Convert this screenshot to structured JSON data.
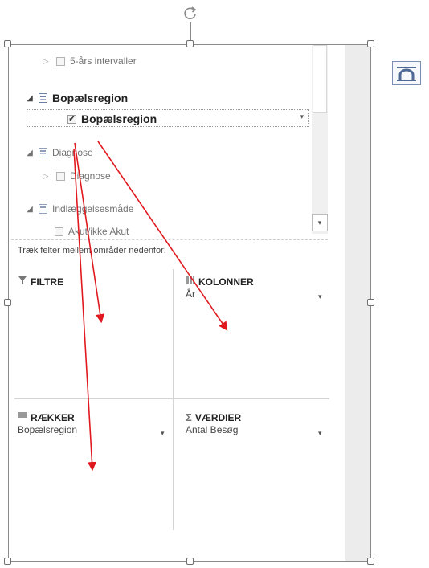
{
  "field_list": {
    "items": [
      {
        "label": "5-års intervaller",
        "level": 1,
        "checked": false,
        "expandable": true
      },
      {
        "label": "Bopælsregion",
        "level": 0,
        "expanded": true,
        "bold": true
      },
      {
        "label": "Bopælsregion",
        "level": 1,
        "checked": true,
        "bold": true,
        "selected": true
      },
      {
        "label": "Diagnose",
        "level": 0,
        "expanded": true
      },
      {
        "label": "Diagnose",
        "level": 1,
        "checked": false,
        "expandable": true
      },
      {
        "label": "Indlæggelsesmåde",
        "level": 0,
        "expanded": true
      },
      {
        "label": "Akut/ikke Akut",
        "level": 1,
        "checked": false
      }
    ]
  },
  "instruction": "Træk felter mellem områder nedenfor:",
  "areas": {
    "filters": {
      "title": "FILTRE",
      "value": ""
    },
    "columns": {
      "title": "KOLONNER",
      "value": "År"
    },
    "rows": {
      "title": "RÆKKER",
      "value": "Bopælsregion"
    },
    "values": {
      "title": "VÆRDIER",
      "value": "Antal Besøg",
      "icon": "Σ"
    }
  },
  "icons": {
    "rotate": "rotate-handle-icon",
    "layout": "wrap-text-layout-icon",
    "expand": "▲",
    "collapse": "▷",
    "dropdown": "▾",
    "check": "✔"
  },
  "colors": {
    "arrow": "#e0191f",
    "frame": "#8a8a8a",
    "accent": "#6a7fa3"
  }
}
